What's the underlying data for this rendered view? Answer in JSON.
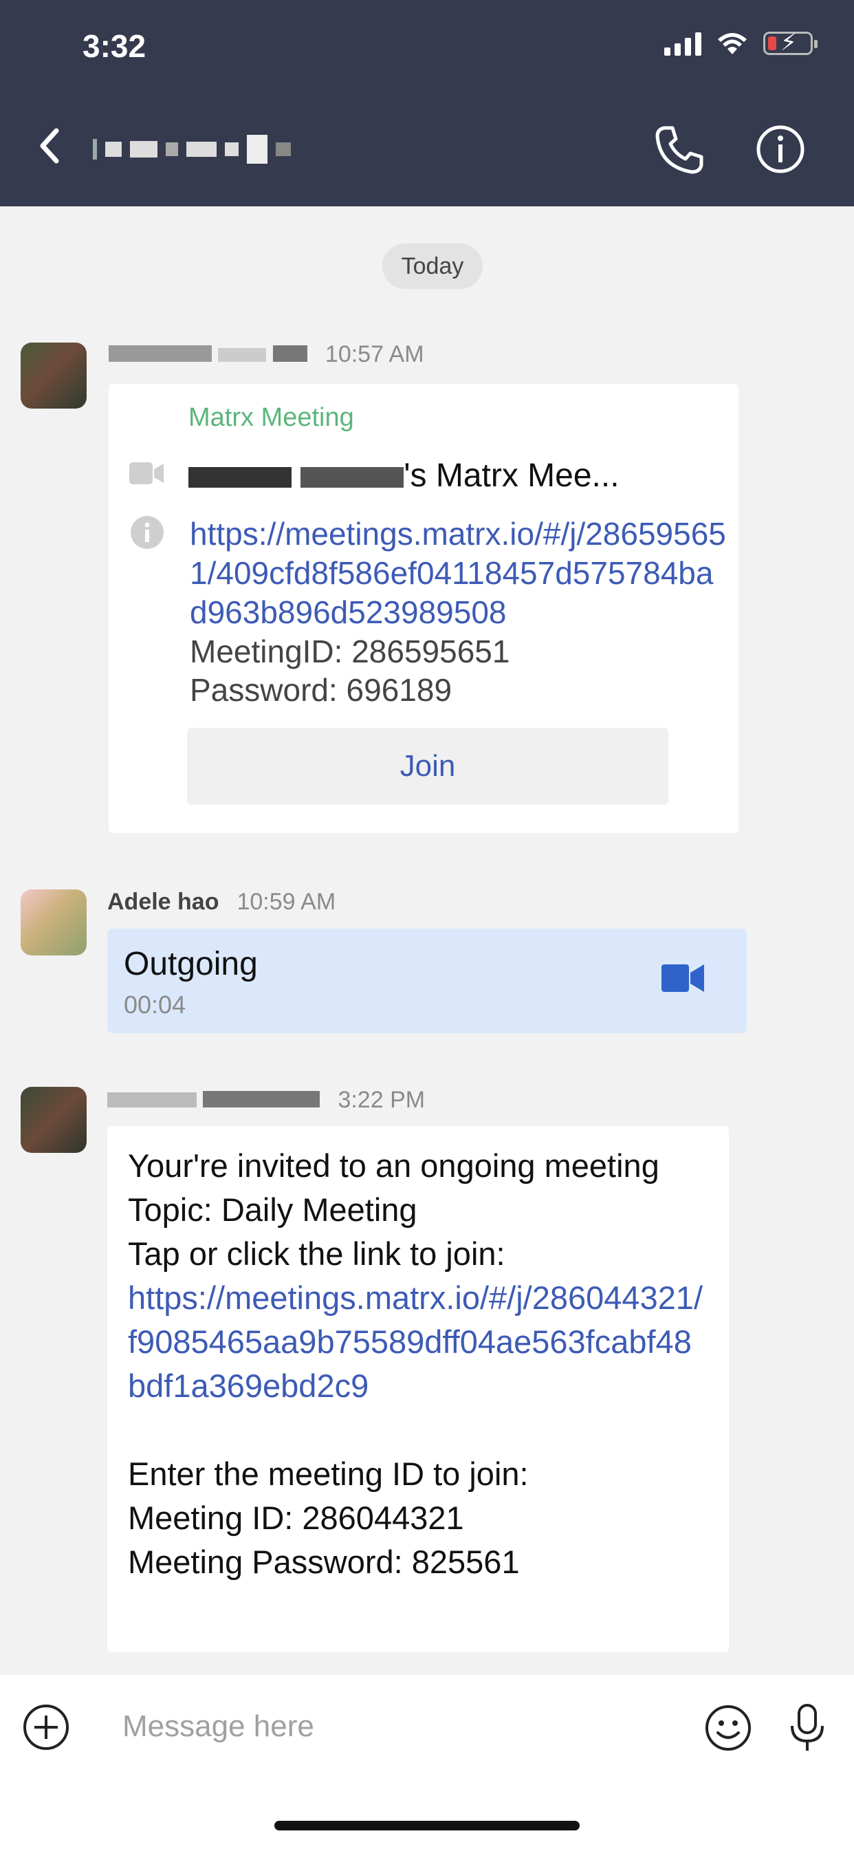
{
  "status_bar": {
    "time": "3:32"
  },
  "header": {
    "back_icon": "chevron-left-icon",
    "call_icon": "phone-icon",
    "info_icon": "info-icon"
  },
  "chat": {
    "date_divider": "Today",
    "messages": [
      {
        "time": "10:57 AM",
        "card": {
          "brand": "Matrx Meeting",
          "title": "'s Matrx Mee...",
          "link": "https://meetings.matrx.io/#/j/286595651/409cfd8f586ef04118457d575784bad963b896d523989508",
          "meeting_id": "MeetingID: 286595651",
          "password": "Password: 696189",
          "join_label": "Join"
        }
      },
      {
        "sender": "Adele hao",
        "time": "10:59 AM",
        "call": {
          "label": "Outgoing",
          "duration": "00:04"
        }
      },
      {
        "time": "3:22 PM",
        "text": {
          "line1": "Your're invited to an ongoing meeting",
          "line2": "Topic: Daily Meeting",
          "line3": "Tap or click the link to join:",
          "link": "https://meetings.matrx.io/#/j/286044321/f9085465aa9b75589dff04ae563fcabf48bdf1a369ebd2c9",
          "line4": "Enter the meeting ID to join:",
          "line5": "Meeting ID: 286044321",
          "line6": "Meeting Password: 825561"
        }
      }
    ]
  },
  "composer": {
    "placeholder": "Message here"
  }
}
